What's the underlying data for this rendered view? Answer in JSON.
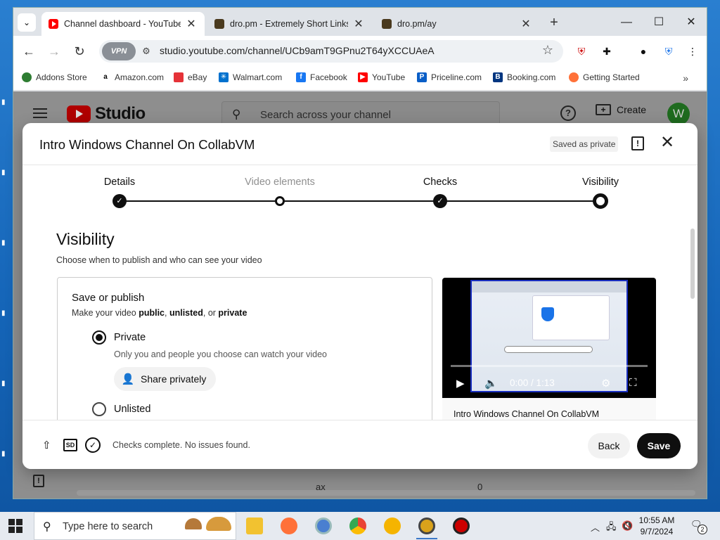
{
  "browser": {
    "tabs": [
      {
        "title": "Channel dashboard - YouTube S"
      },
      {
        "title": "dro.pm - Extremely Short Links"
      },
      {
        "title": "dro.pm/ay"
      }
    ],
    "address": "studio.youtube.com/channel/UCb9amT9GPnu2T64yXCCUAeA",
    "vpn_label": "VPN",
    "bookmarks": [
      {
        "label": "Addons Store"
      },
      {
        "label": "Amazon.com"
      },
      {
        "label": "eBay"
      },
      {
        "label": "Walmart.com"
      },
      {
        "label": "Facebook"
      },
      {
        "label": "YouTube"
      },
      {
        "label": "Priceline.com"
      },
      {
        "label": "Booking.com"
      },
      {
        "label": "Getting Started"
      }
    ]
  },
  "studio": {
    "logo_text": "Studio",
    "search_placeholder": "Search across your channel",
    "create_label": "Create",
    "avatar_letter": "W",
    "bg_cell_1": "ax",
    "bg_cell_2": "0"
  },
  "dialog": {
    "title": "Intro Windows Channel On CollabVM",
    "saved_status": "Saved as private",
    "steps": [
      {
        "label": "Details",
        "state": "done"
      },
      {
        "label": "Video elements",
        "state": "open"
      },
      {
        "label": "Checks",
        "state": "done"
      },
      {
        "label": "Visibility",
        "state": "current"
      }
    ],
    "section_title": "Visibility",
    "section_sub": "Choose when to publish and who can see your video",
    "publish": {
      "title": "Save or publish",
      "sub_prefix": "Make your video ",
      "opt_public": "public",
      "sep1": ", ",
      "opt_unlisted": "unlisted",
      "sep2": ", or ",
      "opt_private": "private",
      "options": [
        {
          "label": "Private",
          "checked": true,
          "desc": "Only you and people you choose can watch your video"
        },
        {
          "label": "Unlisted",
          "checked": false
        }
      ],
      "share_label": "Share privately"
    },
    "preview": {
      "time": "0:00 / 1:13",
      "title": "Intro Windows Channel On CollabVM"
    },
    "footer": {
      "sd_label": "SD",
      "status": "Checks complete. No issues found.",
      "back_label": "Back",
      "save_label": "Save"
    }
  },
  "taskbar": {
    "search_placeholder": "Type here to search",
    "time": "10:55 AM",
    "date": "9/7/2024",
    "notification_count": "2"
  },
  "colors": {
    "youtube_red": "#ff0000",
    "primary_button": "#0f0f0f",
    "desktop_blue": "#1f6fb8"
  }
}
